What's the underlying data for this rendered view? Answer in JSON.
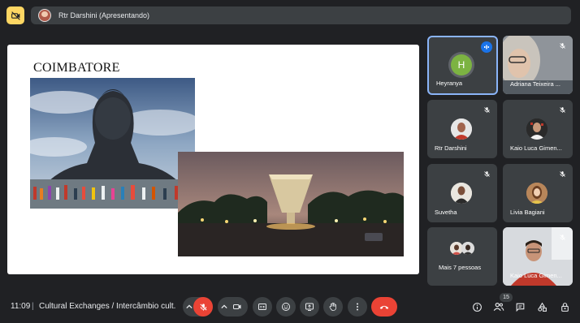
{
  "top_bar": {
    "presenting_label": "Rtr Darshini (Apresentando)"
  },
  "slide": {
    "title": "COIMBATORE"
  },
  "participants": [
    {
      "name": "Heyranya",
      "initial": "H",
      "avatar_color": "#7cb342",
      "speaking": true
    },
    {
      "name": "Adriana Teixeira ...",
      "muted": true
    },
    {
      "name": "Rtr Darshini",
      "muted": true
    },
    {
      "name": "Kaio Luca Gimen...",
      "muted": true
    },
    {
      "name": "Suvetha",
      "muted": true
    },
    {
      "name": "Livia Bagiani",
      "muted": true
    },
    {
      "name": "Mais 7 pessoas"
    },
    {
      "name": "Kaio Luca Gimen...",
      "muted": true
    }
  ],
  "bottom_bar": {
    "time": "11:09",
    "separator": "|",
    "meeting_title": "Cultural Exchanges / Intercâmbio cult...",
    "participant_count": "15"
  },
  "colors": {
    "background": "#202124",
    "tile": "#3c4043",
    "accent_blue": "#8ab4f8",
    "end_call_red": "#ea4335",
    "self_cam_yellow": "#fdd663"
  },
  "icons": [
    "camera-off-icon",
    "speaking-icon",
    "mic-off-icon",
    "chevron-up-icon",
    "camera-icon",
    "captions-icon",
    "emoji-icon",
    "present-icon",
    "raise-hand-icon",
    "more-options-icon",
    "end-call-icon",
    "info-icon",
    "people-icon",
    "chat-icon",
    "activities-icon",
    "host-controls-icon"
  ]
}
